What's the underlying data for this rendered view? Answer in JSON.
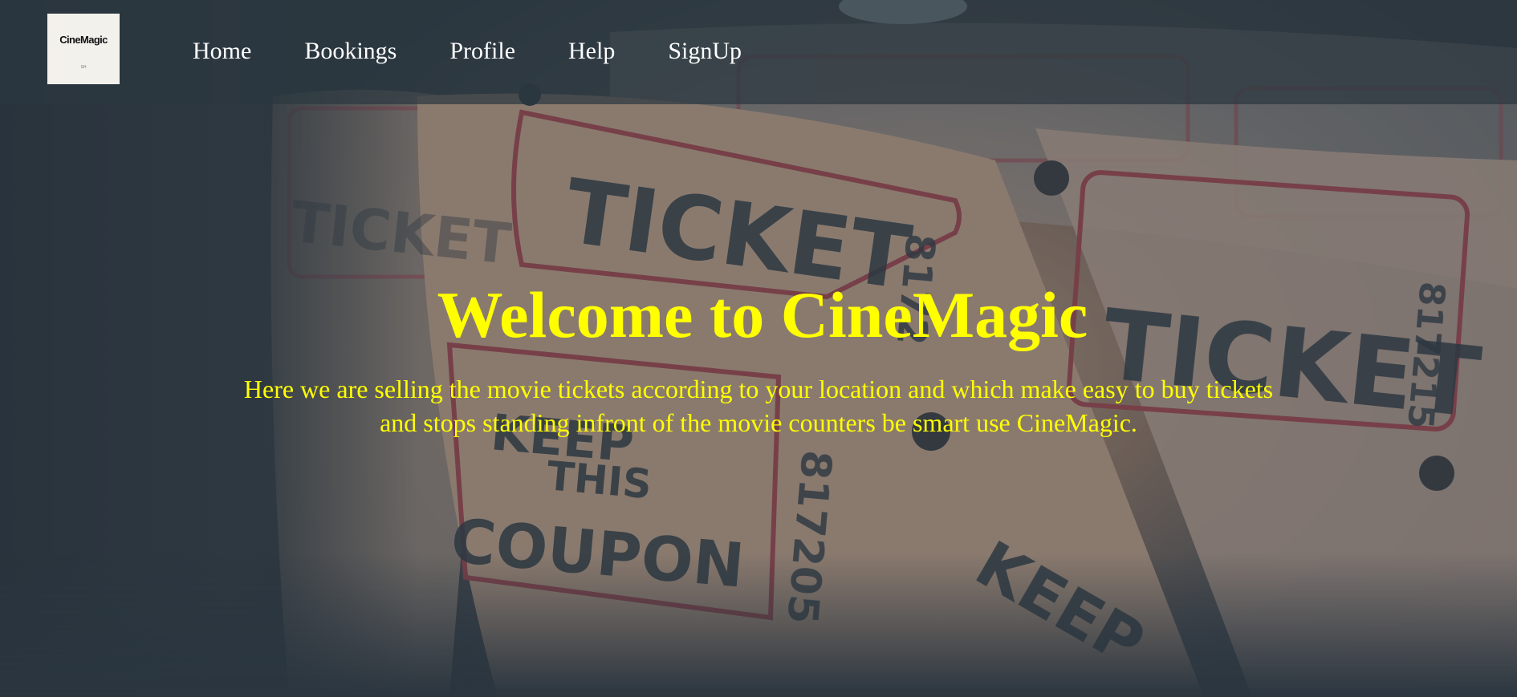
{
  "brand": {
    "logo_text": "CineMagic",
    "logo_subtext": "SH"
  },
  "nav": {
    "items": [
      "Home",
      "Bookings",
      "Profile",
      "Help",
      "SignUp"
    ]
  },
  "hero": {
    "title": "Welcome to CineMagic",
    "description": "Here we are selling the movie tickets according to your location and which make easy to buy tickets and stops standing infront of the movie counters be smart use CineMagic."
  },
  "background": {
    "image_subject": "roll of movie admission tickets",
    "ticket_words": [
      "TICKET",
      "KEEP THIS COUPON"
    ]
  },
  "colors": {
    "hero_text": "#ffff00",
    "nav_text": "#ffffff",
    "nav_bar": "#2d3740"
  }
}
